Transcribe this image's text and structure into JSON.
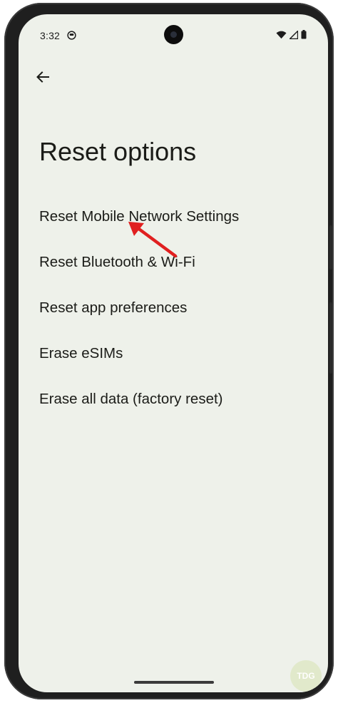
{
  "status_bar": {
    "time": "3:32",
    "app_icon": "face-notification-icon",
    "icons": [
      "wifi-icon",
      "signal-icon",
      "battery-icon"
    ]
  },
  "header": {
    "back_icon": "back-arrow-icon",
    "title": "Reset options"
  },
  "options": [
    {
      "label": "Reset Mobile Network Settings"
    },
    {
      "label": "Reset Bluetooth & Wi-Fi"
    },
    {
      "label": "Reset app preferences"
    },
    {
      "label": "Erase eSIMs"
    },
    {
      "label": "Erase all data (factory reset)"
    }
  ],
  "annotation": {
    "icon": "red-arrow-annotation",
    "color": "#e02020"
  },
  "watermark": {
    "text": "TDG"
  },
  "colors": {
    "screen_background": "#eef1ea",
    "text": "#1b1c18",
    "phone_frame": "#1f1f1f"
  }
}
